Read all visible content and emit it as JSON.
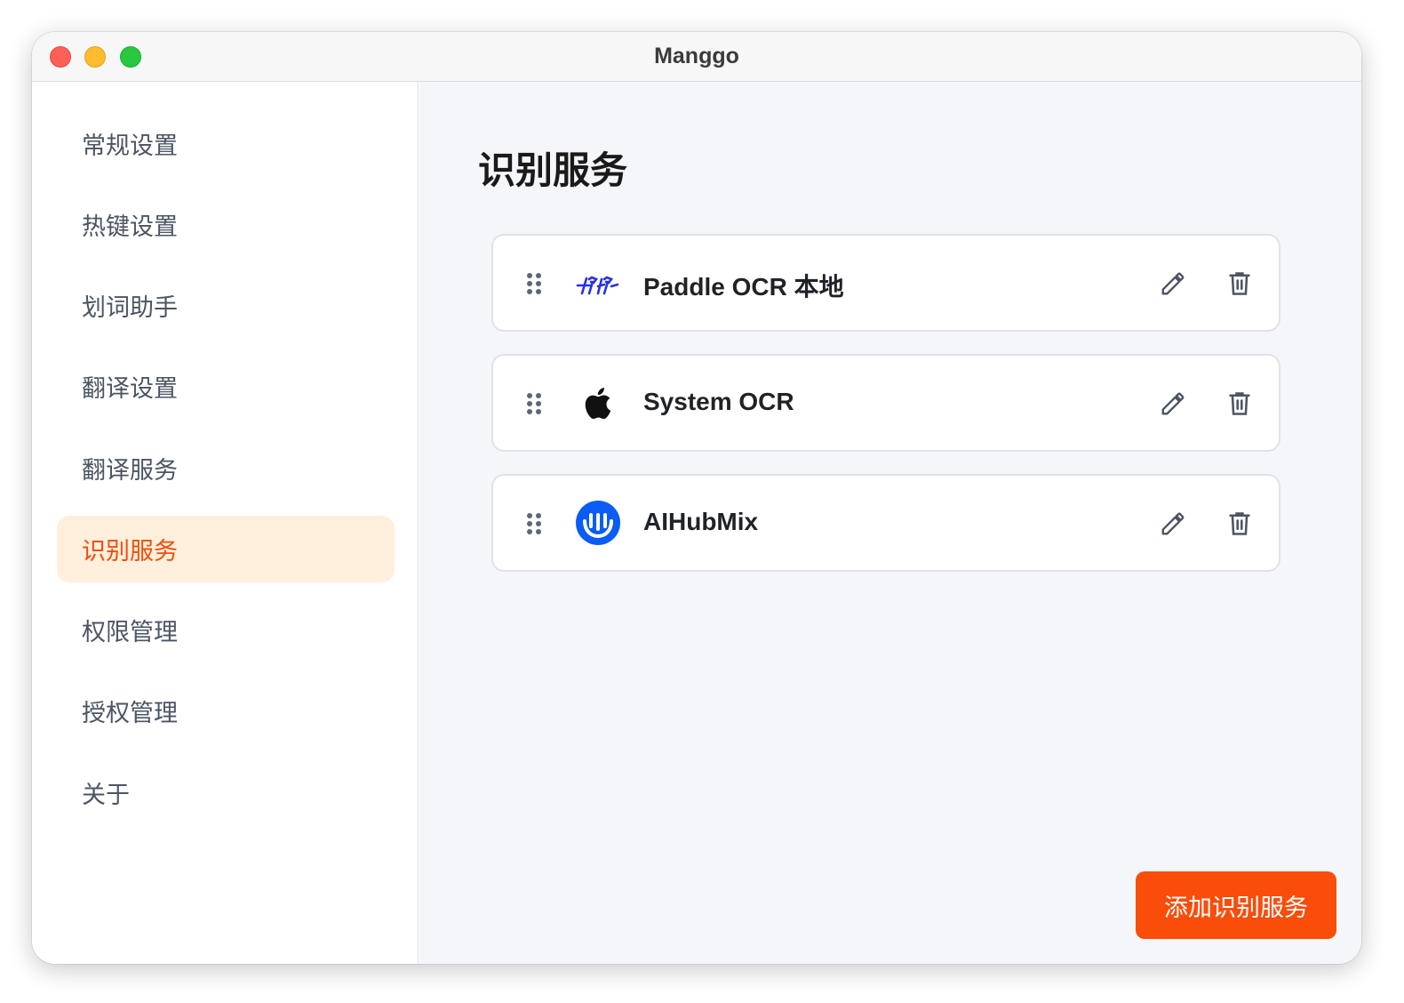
{
  "window": {
    "title": "Manggo"
  },
  "sidebar": {
    "items": [
      {
        "label": "常规设置"
      },
      {
        "label": "热键设置"
      },
      {
        "label": "划词助手"
      },
      {
        "label": "翻译设置"
      },
      {
        "label": "翻译服务"
      },
      {
        "label": "识别服务",
        "active": true
      },
      {
        "label": "权限管理"
      },
      {
        "label": "授权管理"
      },
      {
        "label": "关于"
      }
    ]
  },
  "main": {
    "title": "识别服务",
    "services": [
      {
        "name": "Paddle OCR 本地",
        "icon": "paddle-logo-icon"
      },
      {
        "name": "System OCR",
        "icon": "apple-logo-icon"
      },
      {
        "name": "AIHubMix",
        "icon": "aihubmix-logo-icon"
      }
    ],
    "add_button": "添加识别服务"
  },
  "colors": {
    "accent": "#fa4d0a",
    "active_bg": "#ffefdc",
    "active_text": "#f24d0a",
    "aihubmix_blue": "#0a5cf5",
    "paddle_blue": "#2932e1"
  }
}
